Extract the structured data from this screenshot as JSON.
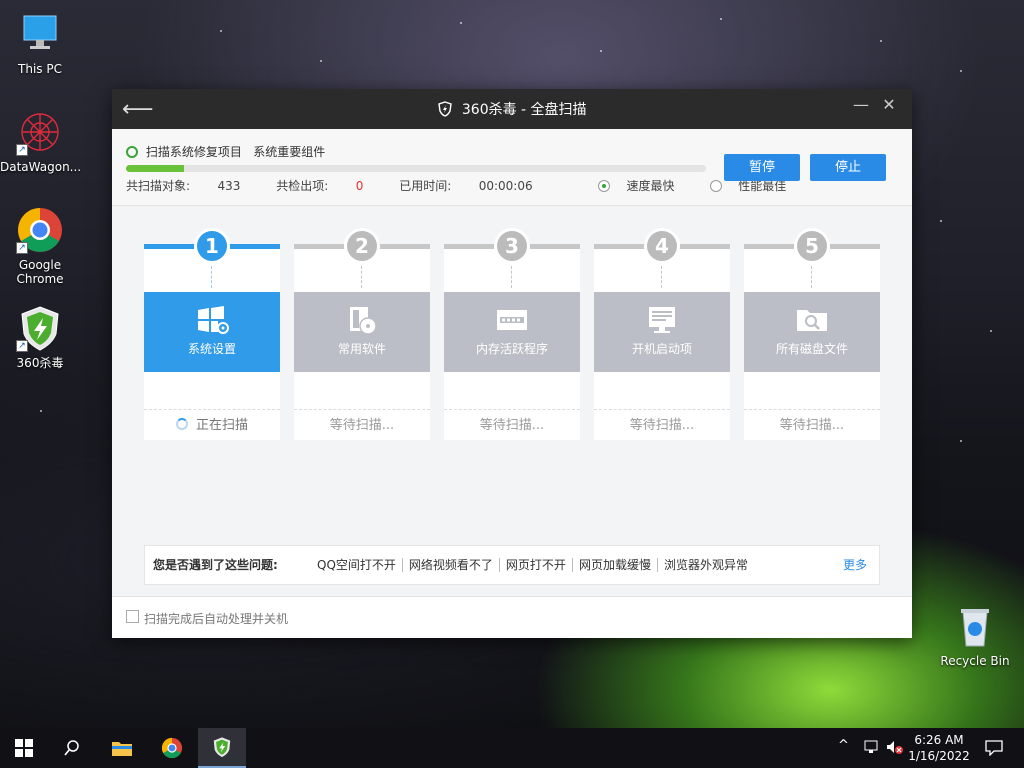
{
  "desktop": {
    "icons": [
      {
        "label": "This PC"
      },
      {
        "label": "DataWagon..."
      },
      {
        "label": "Google Chrome"
      },
      {
        "label": "360杀毒"
      },
      {
        "label": "Recycle Bin"
      }
    ]
  },
  "window": {
    "title": "360杀毒 - 全盘扫描",
    "header": {
      "scan_target": "扫描系统修复项目",
      "scan_item": "系统重要组件",
      "progress_percent": 10,
      "scanned_label": "共扫描对象:",
      "scanned_value": "433",
      "found_label": "共检出项:",
      "found_value": "0",
      "elapsed_label": "已用时间:",
      "elapsed_value": "00:00:06",
      "mode_fast": "速度最快",
      "mode_perf": "性能最佳",
      "pause_label": "暂停",
      "stop_label": "停止"
    },
    "steps": [
      {
        "num": "1",
        "label": "系统设置",
        "status": "正在扫描",
        "icon": "windows-settings-icon"
      },
      {
        "num": "2",
        "label": "常用软件",
        "status": "等待扫描...",
        "icon": "software-disc-icon"
      },
      {
        "num": "3",
        "label": "内存活跃程序",
        "status": "等待扫描...",
        "icon": "memory-icon"
      },
      {
        "num": "4",
        "label": "开机启动项",
        "status": "等待扫描...",
        "icon": "startup-monitor-icon"
      },
      {
        "num": "5",
        "label": "所有磁盘文件",
        "status": "等待扫描...",
        "icon": "folder-search-icon"
      }
    ],
    "issues": {
      "question": "您是否遇到了这些问题:",
      "links": [
        "QQ空间打不开",
        "网络视频看不了",
        "网页打不开",
        "网页加载缓慢",
        "浏览器外观异常"
      ],
      "more": "更多"
    },
    "footer": {
      "auto_shutdown_label": "扫描完成后自动处理并关机"
    }
  },
  "taskbar": {
    "time": "6:26 AM",
    "date": "1/16/2022"
  }
}
